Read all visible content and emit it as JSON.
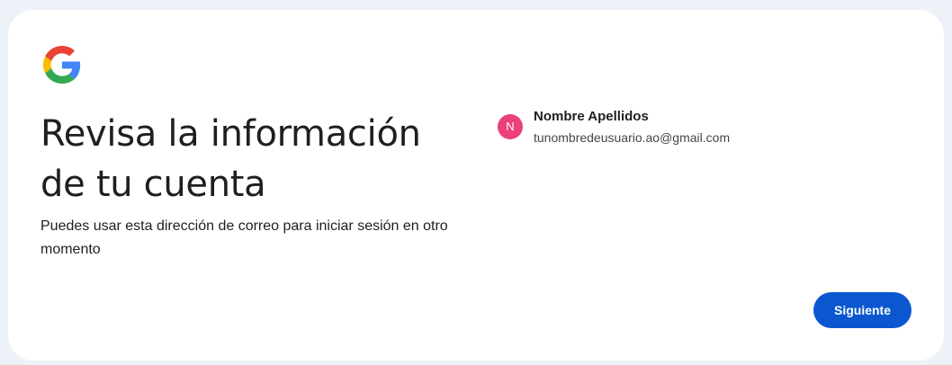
{
  "heading": {
    "title_line1": "Revisa la información",
    "title_line2": "de tu cuenta",
    "subtitle": "Puedes usar esta dirección de correo para iniciar sesión en otro momento"
  },
  "account": {
    "avatar_initial": "N",
    "name": "Nombre Apellidos",
    "email": "tunombredeusuario.ao@gmail.com"
  },
  "actions": {
    "next_label": "Siguiente"
  },
  "icons": {
    "logo": "google-logo-icon"
  },
  "colors": {
    "page_background": "#edf1f8",
    "card_background": "#ffffff",
    "primary_button": "#0b57d0",
    "avatar": "#ec407a",
    "text_primary": "#1f1f1f",
    "text_secondary": "#444746",
    "google_blue": "#4285F4",
    "google_red": "#EA4335",
    "google_yellow": "#FBBC05",
    "google_green": "#34A853"
  }
}
